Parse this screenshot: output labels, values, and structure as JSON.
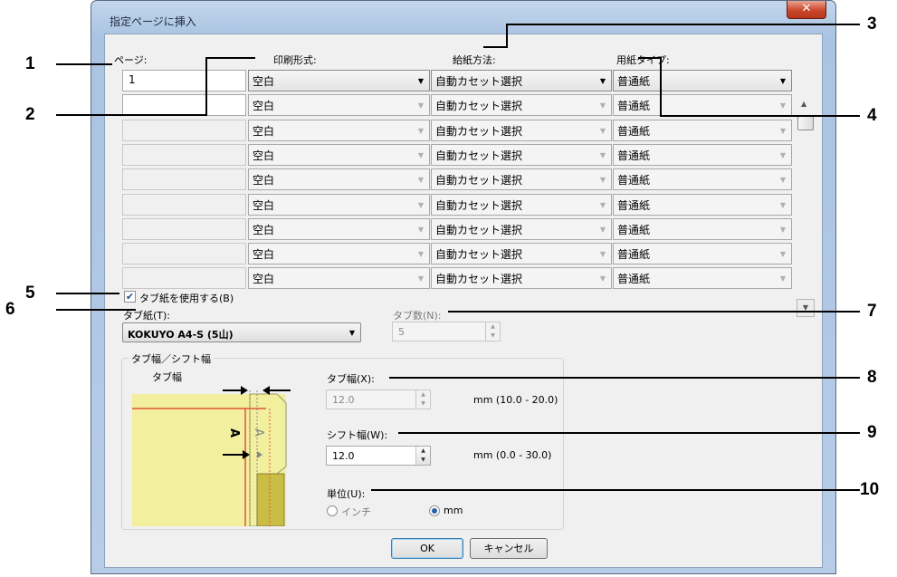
{
  "window": {
    "title": "指定ページに挿入",
    "close_glyph": "✕"
  },
  "table": {
    "headers": {
      "page": "ページ:",
      "print_format": "印刷形式:",
      "paper_source": "給紙方法:",
      "paper_type": "用紙タイプ:"
    },
    "rows": [
      {
        "page": "1",
        "print_format": "空白",
        "paper_source": "自動カセット選択",
        "paper_type": "普通紙"
      },
      {
        "page": "",
        "print_format": "空白",
        "paper_source": "自動カセット選択",
        "paper_type": "普通紙"
      },
      {
        "page": "",
        "print_format": "空白",
        "paper_source": "自動カセット選択",
        "paper_type": "普通紙"
      },
      {
        "page": "",
        "print_format": "空白",
        "paper_source": "自動カセット選択",
        "paper_type": "普通紙"
      },
      {
        "page": "",
        "print_format": "空白",
        "paper_source": "自動カセット選択",
        "paper_type": "普通紙"
      },
      {
        "page": "",
        "print_format": "空白",
        "paper_source": "自動カセット選択",
        "paper_type": "普通紙"
      },
      {
        "page": "",
        "print_format": "空白",
        "paper_source": "自動カセット選択",
        "paper_type": "普通紙"
      },
      {
        "page": "",
        "print_format": "空白",
        "paper_source": "自動カセット選択",
        "paper_type": "普通紙"
      },
      {
        "page": "",
        "print_format": "空白",
        "paper_source": "自動カセット選択",
        "paper_type": "普通紙"
      }
    ]
  },
  "tab_paper": {
    "use_label": "タブ紙を使用する(B)",
    "use_checked": true,
    "paper_label": "タブ紙(T):",
    "paper_value": "KOKUYO A4-S (5山)",
    "count_label": "タブ数(N):",
    "count_value": "5"
  },
  "tab_group": {
    "title": "タブ幅／シフト幅",
    "diagram_label": "タブ幅",
    "diagram_letter": "A",
    "width_label": "タブ幅(X):",
    "width_value": "12.0",
    "width_range": "mm (10.0 - 20.0)",
    "shift_label": "シフト幅(W):",
    "shift_value": "12.0",
    "shift_range": "mm (0.0 - 30.0)",
    "unit_label": "単位(U):",
    "unit_inch": "インチ",
    "unit_mm": "mm",
    "unit_selected": "mm"
  },
  "buttons": {
    "ok": "OK",
    "cancel": "キャンセル"
  },
  "callouts": [
    "1",
    "2",
    "3",
    "4",
    "5",
    "6",
    "7",
    "8",
    "9",
    "10"
  ]
}
